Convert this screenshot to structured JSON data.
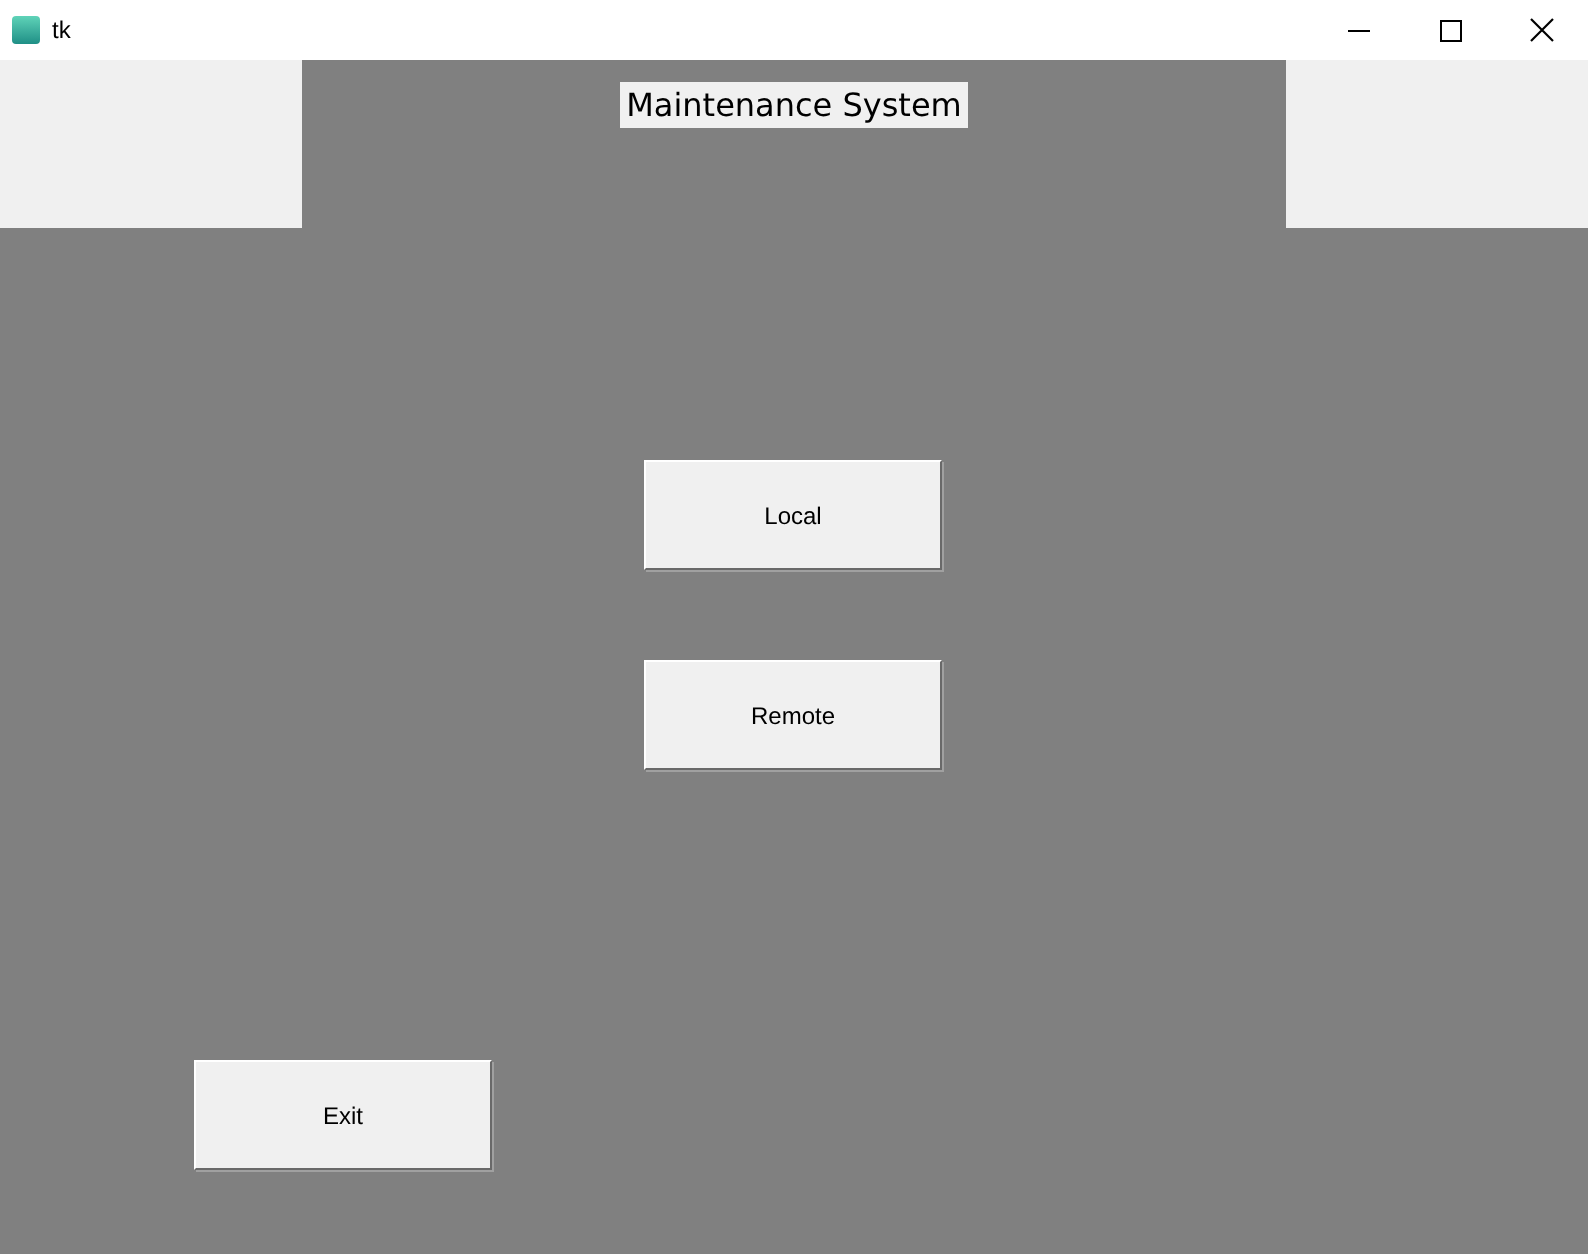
{
  "window": {
    "title": "tk"
  },
  "header": {
    "title": "Maintenance System"
  },
  "menu_buttons": [
    {
      "label": "Local"
    },
    {
      "label": "Remote"
    }
  ],
  "exit_button": {
    "label": "Exit"
  }
}
